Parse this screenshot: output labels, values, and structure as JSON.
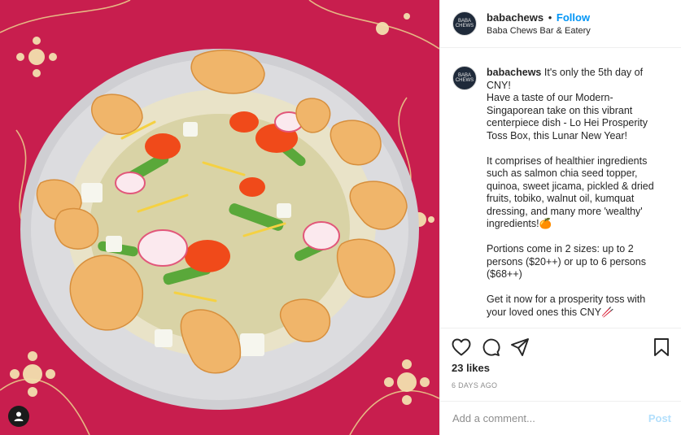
{
  "header": {
    "username": "babachews",
    "separator": "•",
    "follow_label": "Follow",
    "location": "Baba Chews Bar & Eatery",
    "avatar_text": "BABA CHEWS"
  },
  "caption": {
    "username": "babachews",
    "paragraphs": [
      "It's only the 5th day of CNY!\nHave a taste of our Modern-Singaporean take on this vibrant centerpiece dish - Lo Hei Prosperity Toss Box, this Lunar New Year!",
      "It comprises of healthier ingredients such as salmon chia seed topper, quinoa, sweet jicama, pickled & dried fruits, tobiko, walnut oil, kumquat dressing, and many more 'wealthy' ingredients!🍊",
      "Portions come in 2 sizes: up to 2 persons ($20++) or up to 6 persons ($68++)",
      "Get it now for a prosperity toss with your loved ones this CNY🥢"
    ]
  },
  "actions": {
    "icons": [
      "heart-icon",
      "comment-icon",
      "share-icon",
      "bookmark-icon"
    ],
    "likes": "23 likes",
    "date": "6 DAYS AGO"
  },
  "comment": {
    "placeholder": "Add a comment...",
    "post_label": "Post"
  },
  "colors": {
    "background": "#c81e4e",
    "follow": "#0095f6",
    "post_disabled": "#b2dffc"
  }
}
